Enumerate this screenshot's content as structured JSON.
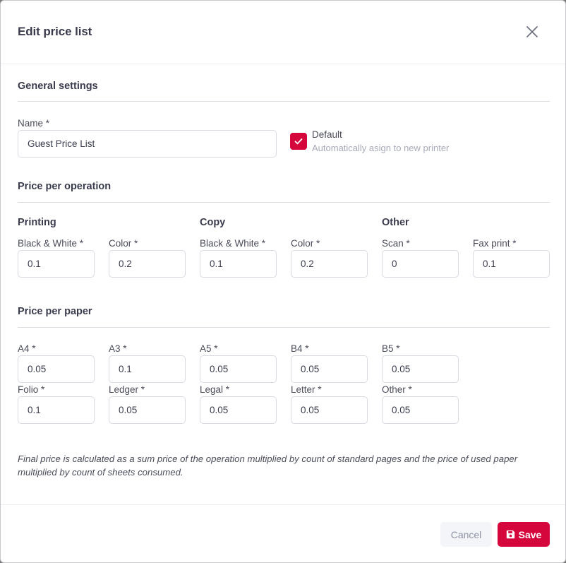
{
  "dialog": {
    "title": "Edit price list",
    "close_icon": "close-icon"
  },
  "general": {
    "title": "General settings",
    "name_label": "Name *",
    "name_value": "Guest Price List",
    "default_label": "Default",
    "default_hint": "Automatically asign to new printer",
    "default_checked": true,
    "accent_color": "#d4063c"
  },
  "operation": {
    "title": "Price per operation",
    "groups": {
      "printing": "Printing",
      "copy": "Copy",
      "other": "Other"
    },
    "fields": [
      {
        "label": "Black & White *",
        "value": "0.1"
      },
      {
        "label": "Color *",
        "value": "0.2"
      },
      {
        "label": "Black & White *",
        "value": "0.1"
      },
      {
        "label": "Color *",
        "value": "0.2"
      },
      {
        "label": "Scan *",
        "value": "0"
      },
      {
        "label": "Fax print *",
        "value": "0.1"
      }
    ]
  },
  "paper": {
    "title": "Price per paper",
    "fields": [
      {
        "label": "A4 *",
        "value": "0.05"
      },
      {
        "label": "A3 *",
        "value": "0.1"
      },
      {
        "label": "A5 *",
        "value": "0.05"
      },
      {
        "label": "B4 *",
        "value": "0.05"
      },
      {
        "label": "B5 *",
        "value": "0.05"
      },
      {
        "label": "Folio *",
        "value": "0.1"
      },
      {
        "label": "Ledger *",
        "value": "0.05"
      },
      {
        "label": "Legal *",
        "value": "0.05"
      },
      {
        "label": "Letter *",
        "value": "0.05"
      },
      {
        "label": "Other *",
        "value": "0.05"
      }
    ]
  },
  "note": "Final price is calculated as a sum price of the operation multiplied by count of standard pages and the price of used paper multiplied by count of sheets consumed.",
  "footer": {
    "cancel_label": "Cancel",
    "save_label": "Save",
    "save_icon": "floppy-disk-icon"
  }
}
